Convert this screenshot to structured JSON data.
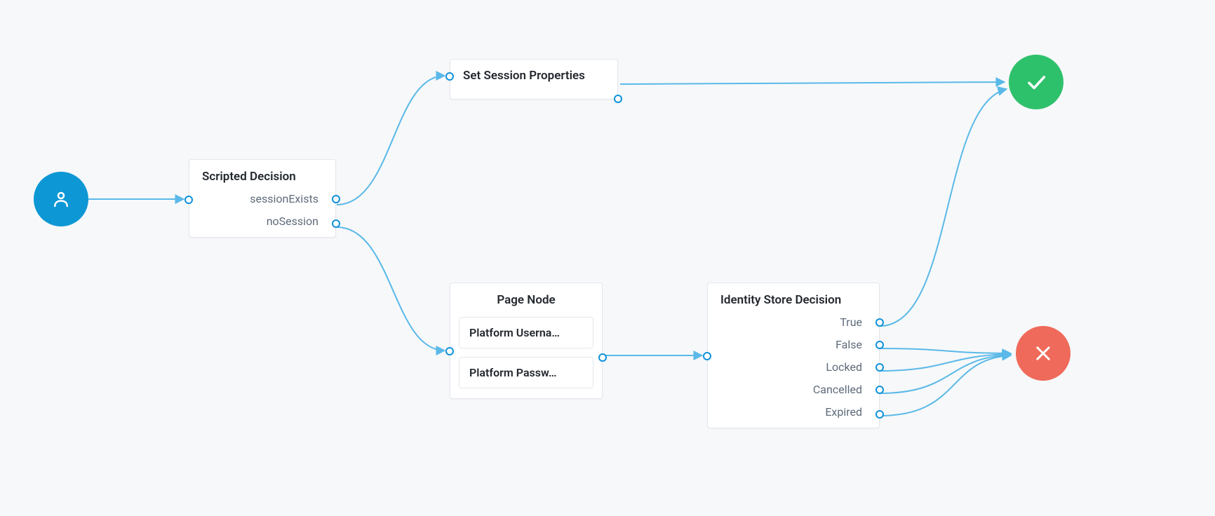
{
  "nodes": {
    "scripted": {
      "title": "Scripted Decision",
      "outcomes": [
        "sessionExists",
        "noSession"
      ]
    },
    "setSession": {
      "title": "Set Session Properties"
    },
    "pageNode": {
      "title": "Page Node",
      "items": [
        "Platform Userna…",
        "Platform Passw…"
      ]
    },
    "idStore": {
      "title": "Identity Store Decision",
      "outcomes": [
        "True",
        "False",
        "Locked",
        "Cancelled",
        "Expired"
      ]
    }
  },
  "terminals": {
    "start": "user-icon",
    "success": "check-icon",
    "fail": "x-icon"
  },
  "colors": {
    "edge": "#5ab9e8",
    "start": "#0d97d5",
    "success": "#2ec16b",
    "fail": "#ef6a5a"
  }
}
